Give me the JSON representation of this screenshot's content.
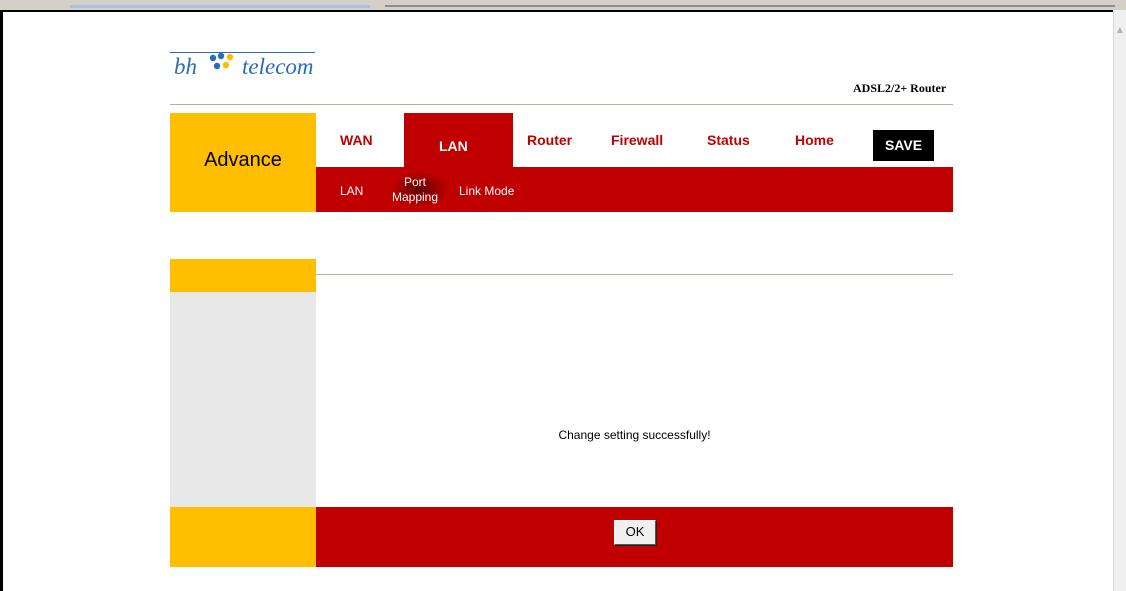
{
  "logo": {
    "bh": "bh",
    "telecom": "telecom"
  },
  "router_title": "ADSL2/2+ Router",
  "section_label": "Advance",
  "nav": {
    "items": [
      {
        "label": "WAN"
      },
      {
        "label": "LAN"
      },
      {
        "label": "Router"
      },
      {
        "label": "Firewall"
      },
      {
        "label": "Status"
      },
      {
        "label": "Home"
      }
    ],
    "active": "LAN",
    "save_label": "SAVE"
  },
  "subnav": {
    "items": [
      {
        "label": "LAN"
      },
      {
        "label_line1": "Port",
        "label_line2": "Mapping"
      },
      {
        "label": "Link Mode"
      }
    ]
  },
  "message": "Change setting successfully!",
  "ok_label": "OK",
  "colors": {
    "brand_red": "#c00000",
    "brand_yellow": "#ffbf00",
    "logo_blue": "#2a6db4"
  }
}
